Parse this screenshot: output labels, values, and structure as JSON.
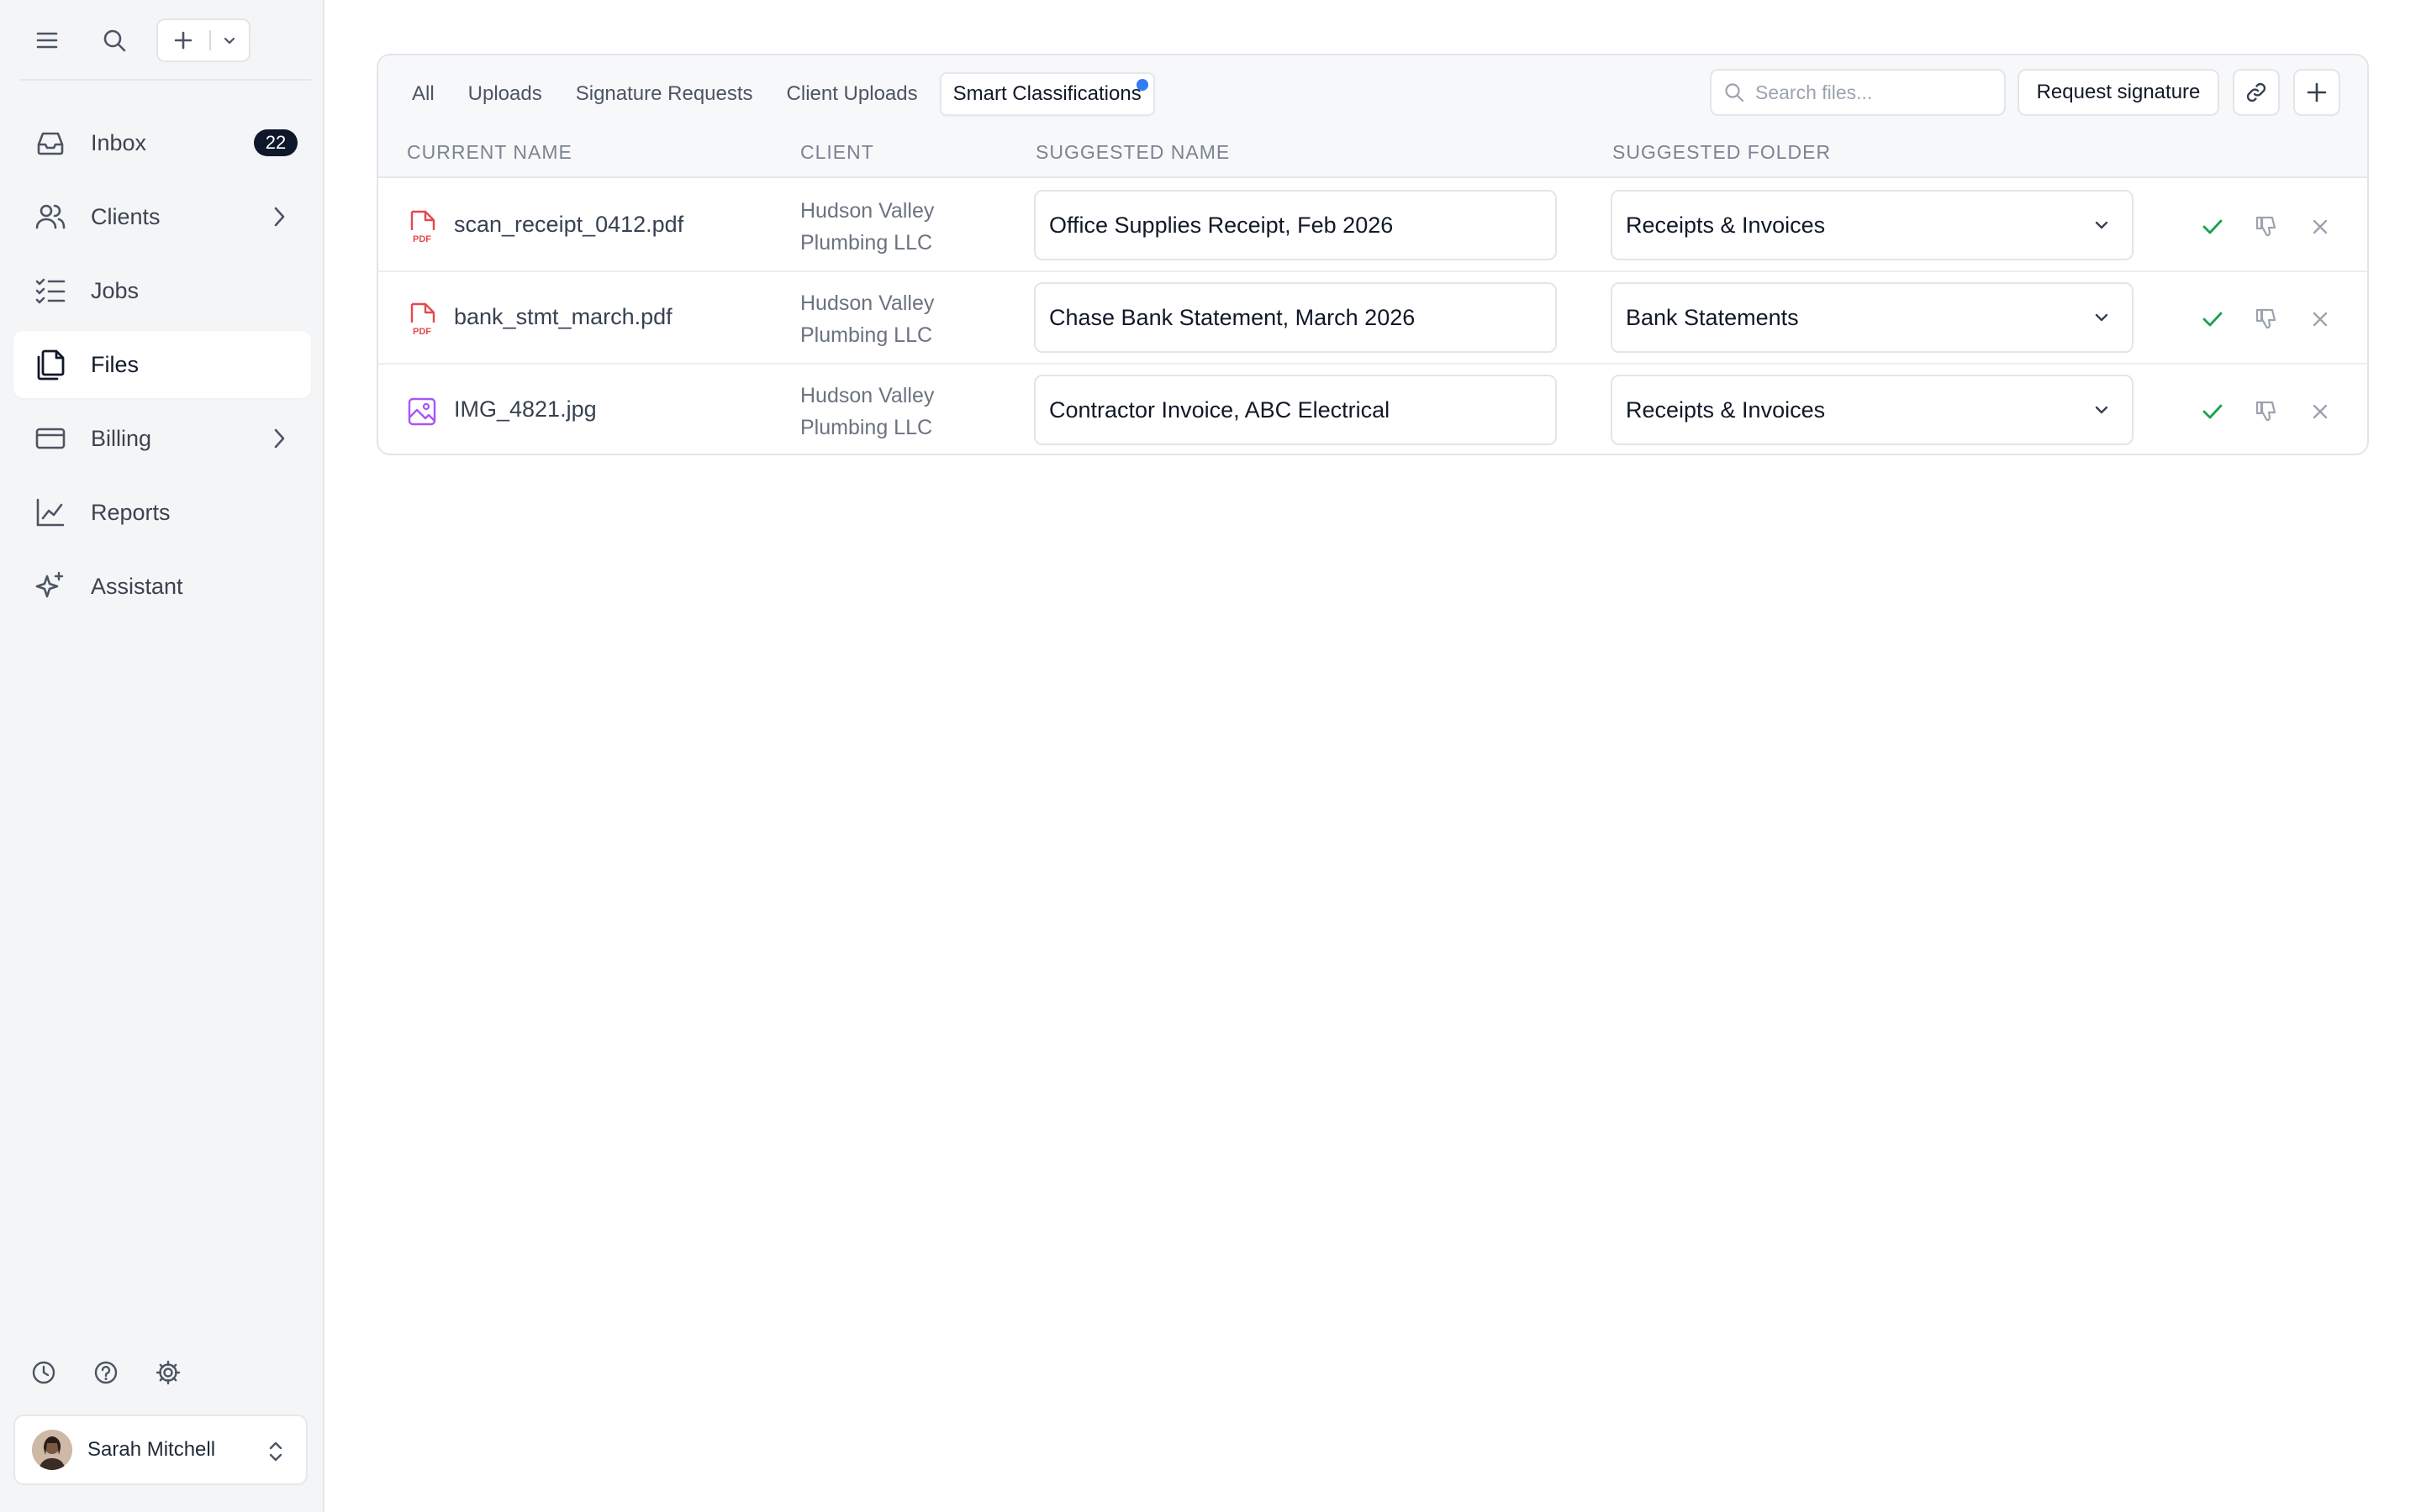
{
  "sidebar": {
    "top_tools": {
      "menu_icon": "hamburger-icon",
      "search_icon": "search-icon",
      "new_icon": "plus-icon",
      "new_menu_icon": "chevron-down-icon"
    },
    "nav": [
      {
        "label": "Inbox",
        "icon": "inbox-icon",
        "badge": "22",
        "active": false
      },
      {
        "label": "Clients",
        "icon": "users-icon",
        "has_submenu": true,
        "active": false
      },
      {
        "label": "Jobs",
        "icon": "checklist-icon",
        "active": false
      },
      {
        "label": "Files",
        "icon": "files-icon",
        "active": true
      },
      {
        "label": "Billing",
        "icon": "credit-card-icon",
        "has_submenu": true,
        "active": false
      },
      {
        "label": "Reports",
        "icon": "line-chart-icon",
        "active": false
      },
      {
        "label": "Assistant",
        "icon": "sparkles-icon",
        "active": false
      }
    ],
    "bottom_tools": [
      "clock-icon",
      "help-icon",
      "gear-icon"
    ],
    "user": {
      "name": "Sarah Mitchell"
    }
  },
  "files": {
    "tabs": [
      {
        "label": "All",
        "active": false
      },
      {
        "label": "Uploads",
        "active": false
      },
      {
        "label": "Signature Requests",
        "active": false
      },
      {
        "label": "Client Uploads",
        "active": false
      },
      {
        "label": "Smart Classifications",
        "active": true,
        "has_dot": true
      }
    ],
    "search": {
      "placeholder": "Search files...",
      "value": ""
    },
    "request_signature_label": "Request signature",
    "columns": {
      "current_name": "CURRENT NAME",
      "client": "CLIENT",
      "suggested_name": "SUGGESTED NAME",
      "suggested_folder": "SUGGESTED FOLDER"
    },
    "rows": [
      {
        "file_name": "scan_receipt_0412.pdf",
        "file_type": "pdf",
        "client": "Hudson Valley Plumbing LLC",
        "suggested_name": "Office Supplies Receipt, Feb 2026",
        "suggested_folder": "Receipts & Invoices"
      },
      {
        "file_name": "bank_stmt_march.pdf",
        "file_type": "pdf",
        "client": "Hudson Valley Plumbing LLC",
        "suggested_name": "Chase Bank Statement, March 2026",
        "suggested_folder": "Bank Statements"
      },
      {
        "file_name": "IMG_4821.jpg",
        "file_type": "image",
        "client": "Hudson Valley Plumbing LLC",
        "suggested_name": "Contractor Invoice, ABC Electrical",
        "suggested_folder": "Receipts & Invoices"
      }
    ]
  },
  "colors": {
    "accent_dot": "#2f7cf6",
    "approve": "#16a34a",
    "pdf": "#e5484d",
    "image": "#a855f7",
    "badge_bg": "#0f172a"
  }
}
